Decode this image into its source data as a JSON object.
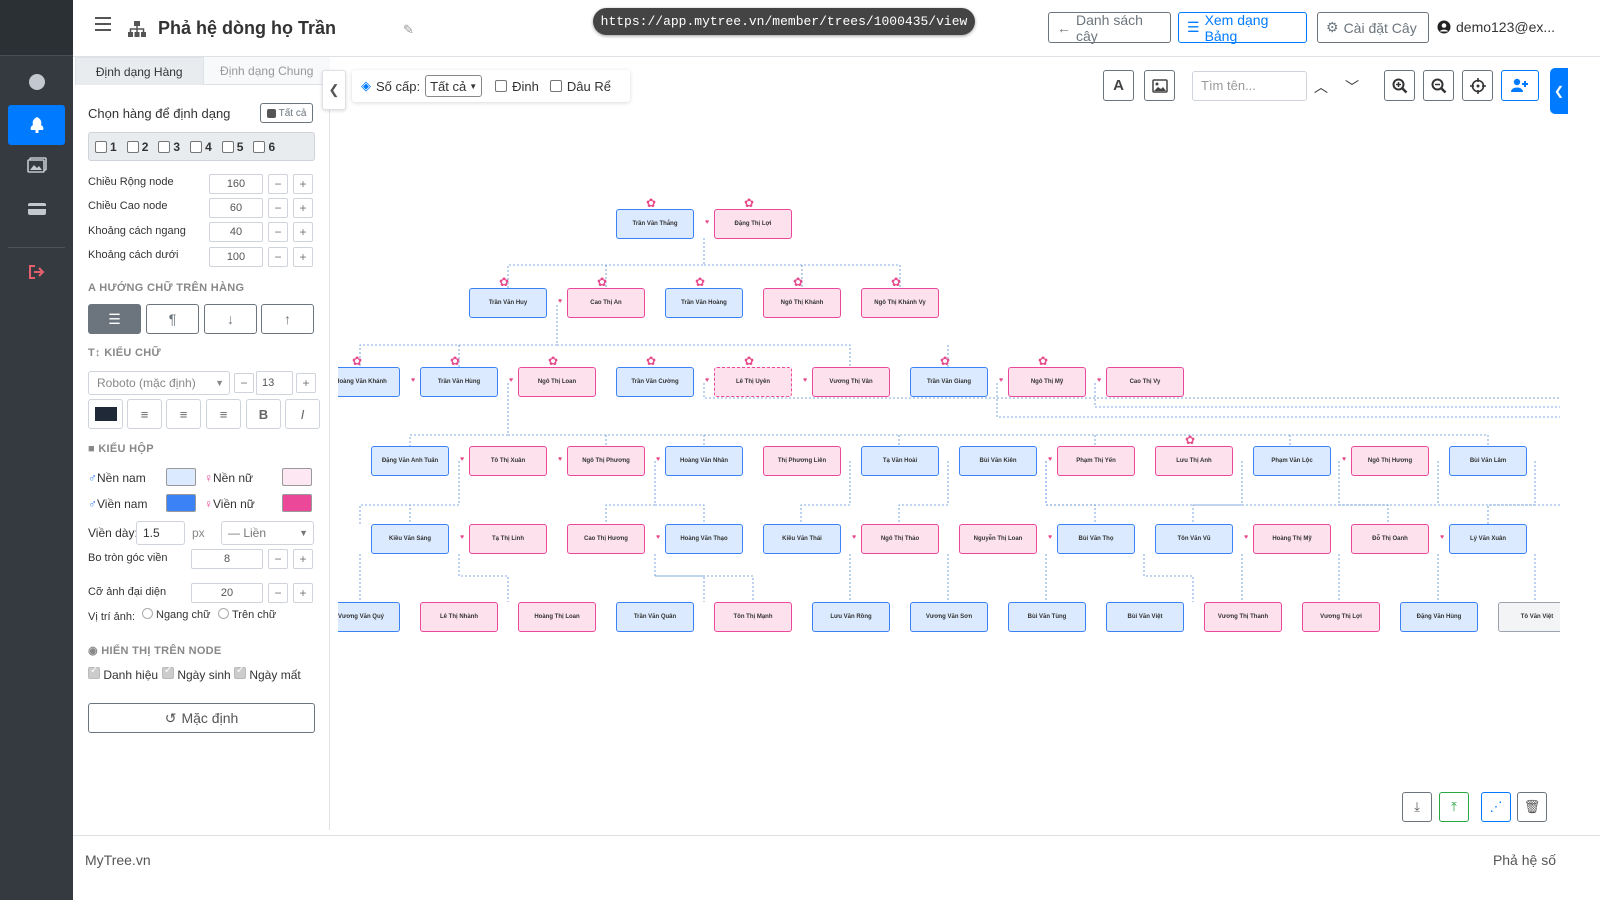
{
  "app": {
    "title": "Phả hệ dòng họ Trần",
    "url": "https://app.mytree.vn/member/trees/1000435/view",
    "user": "demo123@ex..."
  },
  "header": {
    "btn_list": "Danh sách cây",
    "btn_table": "Xem dạng Bảng",
    "btn_settings": "Cài đặt Cây"
  },
  "panel": {
    "tab_row": "Định dạng Hàng",
    "tab_general": "Định dạng Chung",
    "select_rows_label": "Chọn hàng để định dạng",
    "select_all": "Tất cả",
    "rows": [
      "1",
      "2",
      "3",
      "4",
      "5",
      "6"
    ],
    "node_width_label": "Chiều Rộng node",
    "node_width": "160",
    "node_height_label": "Chiều Cao node",
    "node_height": "60",
    "hgap_label": "Khoảng cách ngang",
    "hgap": "40",
    "vgap_label": "Khoảng cách dưới",
    "vgap": "100",
    "text_dir_title": "HƯỚNG CHỮ TRÊN HÀNG",
    "font_title": "KIỂU CHỮ",
    "font_family": "Roboto (mặc định)",
    "font_size": "13",
    "box_title": "KIỂU HỘP",
    "bg_male": "Nền nam",
    "bg_female": "Nền nữ",
    "border_male": "Viền nam",
    "border_female": "Viền nữ",
    "border_width_label": "Viền dày:",
    "border_width": "1.5",
    "border_unit": "px",
    "border_style": "— Liền",
    "radius_label": "Bo tròn góc viền",
    "radius": "8",
    "avatar_label": "Cỡ ảnh đại diện",
    "avatar": "20",
    "img_pos_label": "Vị trí ảnh:",
    "img_pos_1": "Ngang chữ",
    "img_pos_2": "Trên chữ",
    "display_title": "HIỂN THỊ TRÊN NODE",
    "show_title": "Danh hiệu",
    "show_birth": "Ngày sinh",
    "show_death": "Ngày mất",
    "reset": "Mặc định",
    "colors": {
      "bg_male": "#dbeafe",
      "bg_female": "#fce7f3",
      "border_male": "#3b82f6",
      "border_female": "#ec4899",
      "text": "#1f2937"
    }
  },
  "toolbar": {
    "level_label": "Số cấp:",
    "level_value": "Tất cả",
    "pin_label": "Đinh",
    "inlaw_label": "Dâu Rể",
    "search_placeholder": "Tìm tên..."
  },
  "tree": {
    "g1": [
      "Trần Văn Thắng",
      "Đặng Thị Lợi"
    ],
    "g2": [
      "Trần Văn Huy",
      "Cao Thị An",
      "Trần Văn Hoàng",
      "Ngô Thị Khánh",
      "Ngô Thị Khánh Vy"
    ],
    "g3": [
      "Hoàng Văn Khánh",
      "Trần Văn Hùng",
      "Ngô Thị Loan",
      "Trần Văn Cường",
      "Lê Thị Uyên",
      "Vương Thị Vân",
      "Trần Văn Giang",
      "Ngô Thị Mỹ",
      "Cao Thị Vy"
    ],
    "g4": [
      "Đặng Văn Anh Tuấn",
      "Tô Thị Xuân",
      "Ngô Thị Phương",
      "Hoàng Văn Nhân",
      "Thị Phương Liên",
      "Tạ Văn Hoài",
      "Bùi Văn Kiên",
      "Phạm Thị Yến",
      "Lưu Thị Anh",
      "Phạm Văn Lộc",
      "Ngô Thị Hương",
      "Bùi Văn Lâm"
    ],
    "g5": [
      "Kiều Văn Sáng",
      "Tạ Thị Linh",
      "Cao Thị Hương",
      "Hoàng Văn Thạo",
      "Kiều Văn Thái",
      "Ngô Thị Thảo",
      "Nguyễn Thị Loan",
      "Bùi Văn Thọ",
      "Tôn Văn Vũ",
      "Hoàng Thị Mỹ",
      "Đỗ Thị Oanh",
      "Lý Văn Xuân"
    ],
    "g6": [
      "Vương Văn Quý",
      "Lê Thị Nhành",
      "Hoàng Thị Loan",
      "Trần Văn Quân",
      "Tôn Thị Mạnh",
      "Lưu Văn Rồng",
      "Vương Văn Sơn",
      "Bùi Văn Tùng",
      "Bùi Văn Việt",
      "Vương Thị Thanh",
      "Vương Thị Lợi",
      "Đặng Văn Hùng",
      "Tô Văn Việt"
    ]
  },
  "footer": {
    "left": "MyTree.vn",
    "right": "Phả hệ số"
  }
}
